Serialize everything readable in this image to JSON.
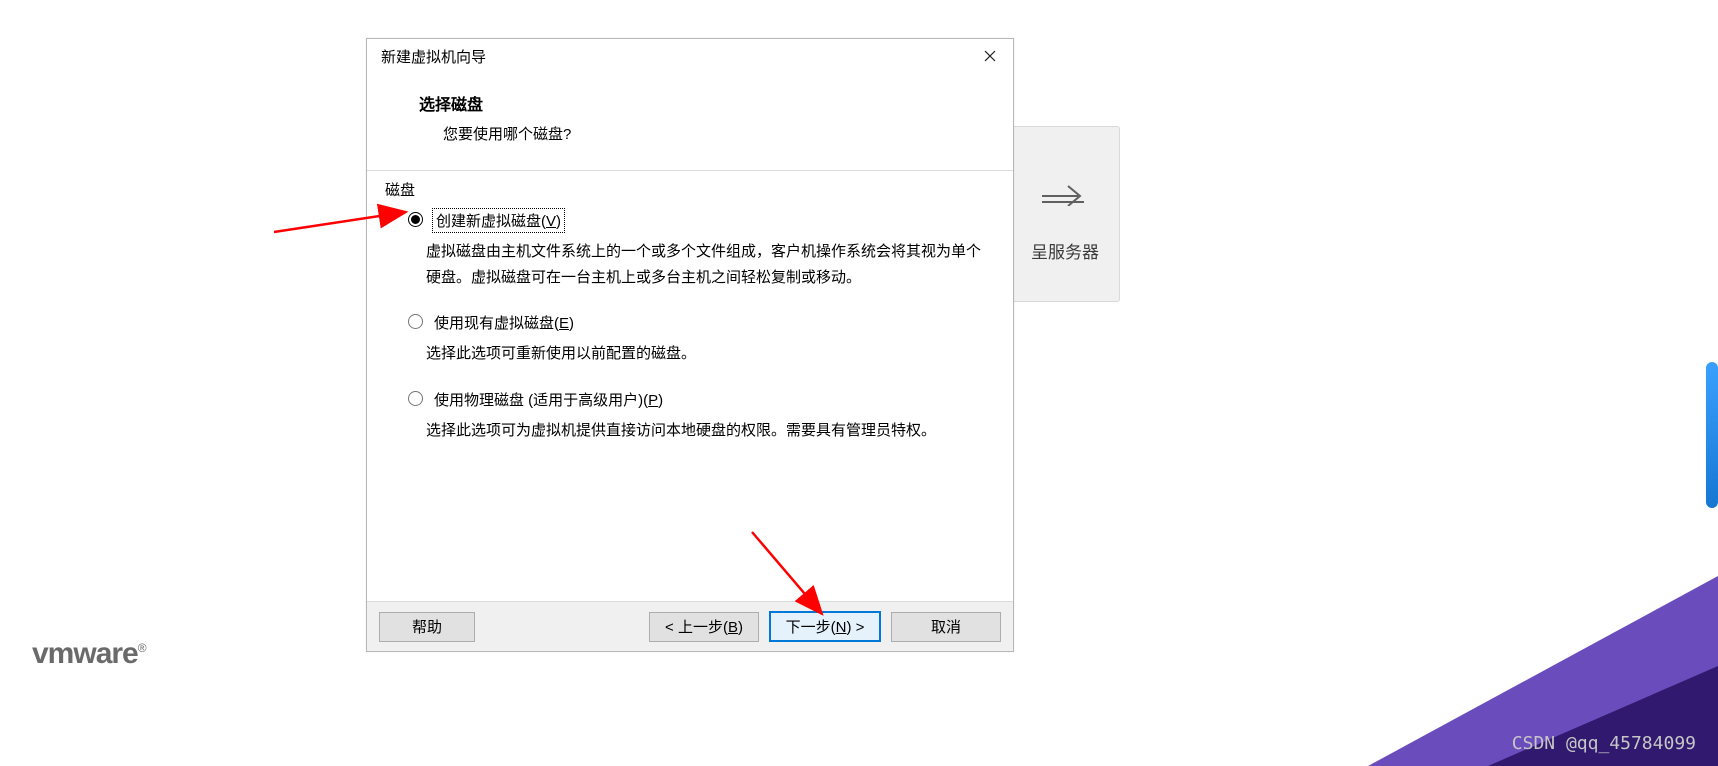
{
  "dialog": {
    "title": "新建虚拟机向导",
    "step_title": "选择磁盘",
    "step_question": "您要使用哪个磁盘?",
    "group_label": "磁盘"
  },
  "options": {
    "create": {
      "label_pre": "创建新虚拟磁盘(",
      "mnemonic": "V",
      "label_post": ")",
      "desc": "虚拟磁盘由主机文件系统上的一个或多个文件组成，客户机操作系统会将其视为单个硬盘。虚拟磁盘可在一台主机上或多台主机之间轻松复制或移动。"
    },
    "existing": {
      "label_pre": "使用现有虚拟磁盘(",
      "mnemonic": "E",
      "label_post": ")",
      "desc": "选择此选项可重新使用以前配置的磁盘。"
    },
    "physical": {
      "label_pre": "使用物理磁盘 (适用于高级用户)(",
      "mnemonic": "P",
      "label_post": ")",
      "desc": "选择此选项可为虚拟机提供直接访问本地硬盘的权限。需要具有管理员特权。"
    }
  },
  "buttons": {
    "help": "帮助",
    "back_pre": "< 上一步(",
    "back_m": "B",
    "back_post": ")",
    "next_pre": "下一步(",
    "next_m": "N",
    "next_post": ") >",
    "cancel": "取消"
  },
  "background": {
    "card_label": "呈服务器"
  },
  "logo": {
    "text": "vmware",
    "reg": "®"
  },
  "watermark": "CSDN @qq_45784099"
}
